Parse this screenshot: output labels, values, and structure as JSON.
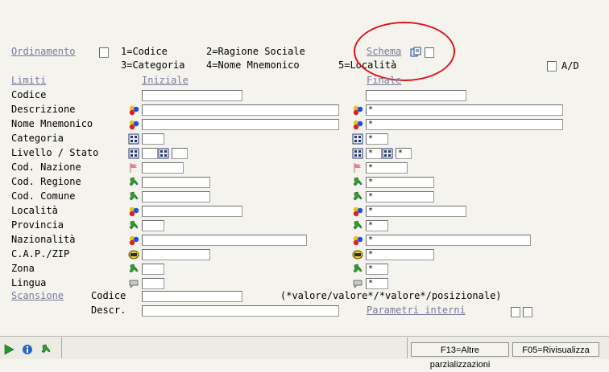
{
  "sort": {
    "label": "Ordinamento",
    "options": [
      "1=Codice",
      "2=Ragione Sociale",
      "3=Categoria",
      "4=Nome Mnemonico",
      "5=Località"
    ],
    "schema_label": "Schema",
    "ad_label": "A/D"
  },
  "headers": {
    "limiti": "Limiti",
    "iniziale": "Iniziale",
    "finale": "Finale"
  },
  "rows": [
    {
      "label": "Codice",
      "icon": "none",
      "final": ""
    },
    {
      "label": "Descrizione",
      "icon": "color-balls-icon",
      "final": "*"
    },
    {
      "label": "Nome Mnemonico",
      "icon": "color-balls-icon",
      "final": "*"
    },
    {
      "label": "Categoria",
      "icon": "grid-lookup-icon",
      "final": "*"
    },
    {
      "label": "Livello / Stato",
      "icon": "grid-lookup-icon",
      "final": "*"
    },
    {
      "label": "Cod. Nazione",
      "icon": "flag-icon",
      "final": "*"
    },
    {
      "label": "Cod. Regione",
      "icon": "italy-map-icon",
      "final": "*"
    },
    {
      "label": "Cod. Comune",
      "icon": "italy-map-icon",
      "final": "*"
    },
    {
      "label": "Località",
      "icon": "color-balls-icon",
      "final": "*"
    },
    {
      "label": "Provincia",
      "icon": "italy-map-icon",
      "final": "*"
    },
    {
      "label": "Nazionalità",
      "icon": "color-balls-icon",
      "final": "*"
    },
    {
      "label": "C.A.P./ZIP",
      "icon": "mailbox-icon",
      "final": "*"
    },
    {
      "label": "Zona",
      "icon": "italy-map-icon",
      "final": "*"
    },
    {
      "label": "Lingua",
      "icon": "speech-icon",
      "final": "*"
    }
  ],
  "livello_final2": "*",
  "scansione": {
    "label": "Scansione",
    "codice_label": "Codice",
    "descr_label": "Descr.",
    "hint": "(*valore/valore*/*valore*/posizionale)",
    "param_label": "Parametri interni"
  },
  "footer": {
    "f13": "F13=Altre parzializzazioni",
    "f05": "F05=Rivisualizza"
  },
  "colors": {
    "link": "#7a7a9a",
    "highlight": "#e0141c",
    "background": "#f4f3ee"
  }
}
